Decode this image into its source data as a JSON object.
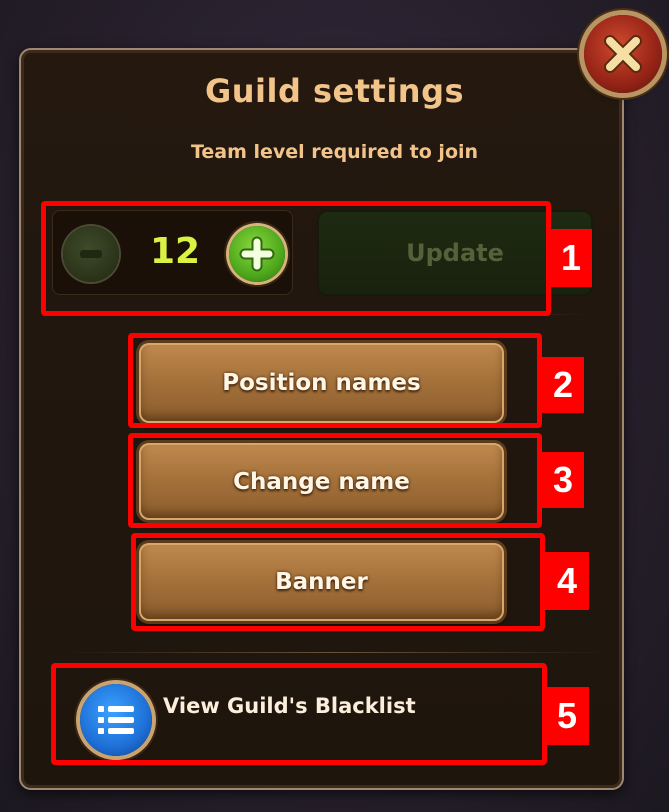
{
  "dialog": {
    "title": "Guild settings",
    "subtitle": "Team level required to join",
    "close_icon": "close-x-icon"
  },
  "level": {
    "value": "12",
    "decrease_icon": "minus-icon",
    "increase_icon": "plus-icon",
    "update_label": "Update"
  },
  "actions": {
    "position_names_label": "Position names",
    "change_name_label": "Change name",
    "banner_label": "Banner"
  },
  "blacklist": {
    "label": "View Guild's Blacklist",
    "icon": "list-icon"
  },
  "annotations": [
    "1",
    "2",
    "3",
    "4",
    "5"
  ],
  "colors": {
    "title": "#f2c48a",
    "level_value": "#d9f244",
    "highlight": "#ff0000",
    "update_disabled_text": "#55613a"
  }
}
